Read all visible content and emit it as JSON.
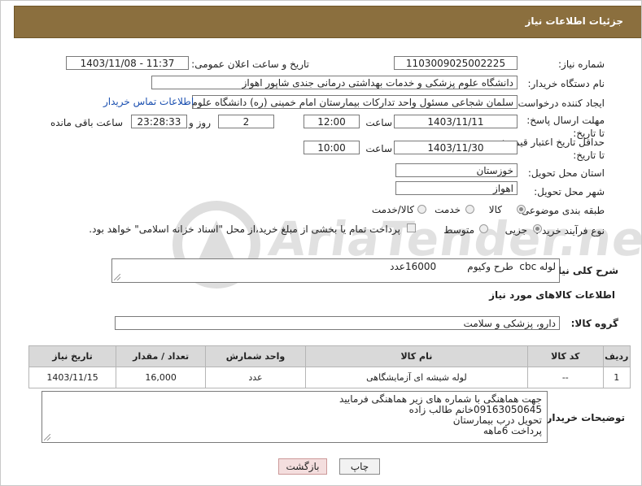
{
  "header": {
    "title": "جزئیات اطلاعات نیاز"
  },
  "watermark": {
    "text": "AriaTender.neT"
  },
  "form": {
    "need_number_label": "شماره نیاز:",
    "need_number": "1103009025002225",
    "announce_label": "تاریخ و ساعت اعلان عمومی:",
    "announce_value": "1403/11/08 - 11:37",
    "buyer_org_label": "نام دستگاه خریدار:",
    "buyer_org": "دانشگاه علوم پزشکی و خدمات بهداشتی درمانی جندی شاپور اهواز",
    "creator_label": "ایجاد کننده درخواست:",
    "creator": "سلمان شجاعی مسئول واحد تدارکات بیمارستان امام خمینی (ره) دانشگاه علوم",
    "contact_link": "اطلاعات تماس خریدار",
    "deadline_label": "مهلت ارسال پاسخ: تا تاریخ:",
    "deadline_date": "1403/11/11",
    "time_label": "ساعت",
    "deadline_time": "12:00",
    "days_value": "2",
    "days_label": "روز و",
    "remaining_time": "23:28:33",
    "remaining_label": "ساعت باقی مانده",
    "validity_label": "حداقل تاریخ اعتبار قیمت: تا تاریخ:",
    "validity_date": "1403/11/30",
    "validity_time": "10:00",
    "province_label": "استان محل تحویل:",
    "province": "خوزستان",
    "city_label": "شهر محل تحویل:",
    "city": "اهواز",
    "category_label": "طبقه بندی موضوعی:",
    "category_options": [
      "کالا",
      "خدمت",
      "کالا/خدمت"
    ],
    "process_label": "نوع فرآیند خرید :",
    "process_options": [
      "جزیی",
      "متوسط"
    ],
    "payment_note": "پرداخت تمام یا بخشی از مبلغ خرید،از محل \"اسناد خزانه اسلامی\" خواهد بود."
  },
  "summary": {
    "label": "شرح کلی نیاز:",
    "value": "لوله cbc  طرح وکیوم          16000عدد"
  },
  "goods": {
    "section_title": "اطلاعات کالاهای مورد نیاز",
    "group_label": "گروه کالا:",
    "group_value": "دارو، پزشکی و سلامت",
    "columns": [
      "ردیف",
      "کد کالا",
      "نام کالا",
      "واحد شمارش",
      "تعداد / مقدار",
      "تاریخ نیاز"
    ],
    "rows": [
      {
        "row": "1",
        "code": "--",
        "name": "لوله شیشه ای آزمایشگاهی",
        "unit": "عدد",
        "qty": "16,000",
        "date": "1403/11/15"
      }
    ]
  },
  "buyer_notes": {
    "label": "توضیحات خریدار:",
    "lines": [
      "جهت هماهنگی با شماره های زیر هماهنگی فرمایید",
      "09163050645خانم طالب زاده",
      "تحویل درب بیمارستان",
      "پرداخت 6ماهه"
    ]
  },
  "buttons": {
    "print": "چاپ",
    "back": "بازگشت"
  }
}
